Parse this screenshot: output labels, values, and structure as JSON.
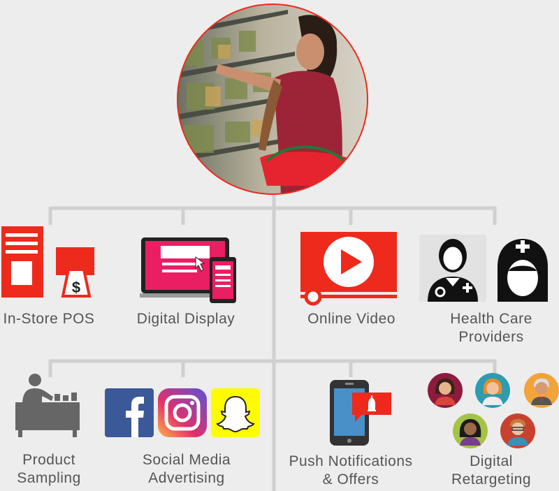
{
  "hero": {
    "image": "woman-shopping-in-grocery-store"
  },
  "colors": {
    "brand_red": "#ee2a1c",
    "connector": "#d0d0d0",
    "text": "#555555"
  },
  "channels": {
    "in_store_pos": "In-Store POS",
    "digital_display": "Digital Display",
    "online_video": "Online Video",
    "health_care_providers": "Health Care\nProviders",
    "product_sampling": "Product\nSampling",
    "social_media_advertising": "Social Media\nAdvertising",
    "push_notifications_offers": "Push Notifications\n& Offers",
    "digital_retargeting": "Digital\nRetargeting"
  },
  "icons": {
    "in_store_pos": "pos-display-icon",
    "digital_display": "laptop-phone-display-icon",
    "online_video": "video-play-icon",
    "health_care_providers": [
      "doctor-icon",
      "nurse-icon"
    ],
    "product_sampling": "sampling-table-icon",
    "social_media_advertising": [
      "facebook-icon",
      "instagram-icon",
      "snapchat-icon"
    ],
    "push_notifications_offers": "phone-notification-icon",
    "digital_retargeting": [
      "avatar-icon",
      "avatar-icon",
      "avatar-icon",
      "avatar-icon",
      "avatar-icon"
    ]
  }
}
